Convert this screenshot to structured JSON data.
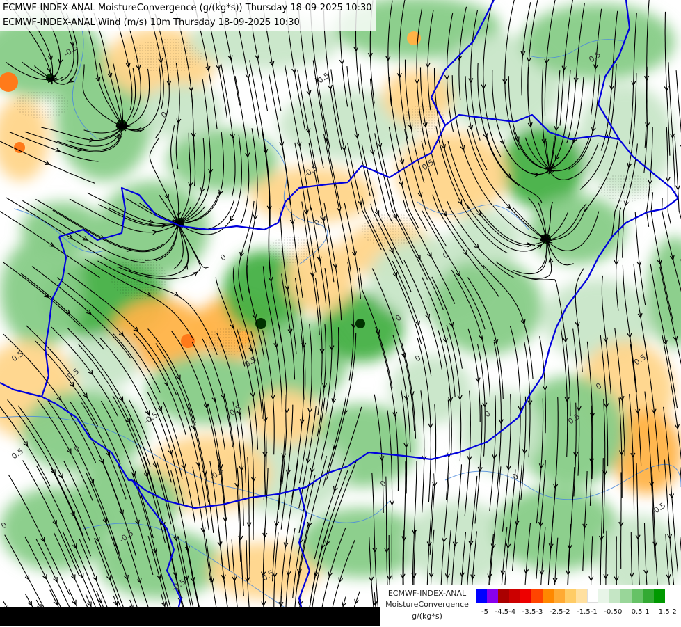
{
  "titles": {
    "line1": "ECMWF-INDEX-ANAL MoistureConvergence (g/(kg*s)) Thursday 18-09-2025 10:30",
    "line2": "ECMWF-INDEX-ANAL Wind (m/s) 10m Thursday 18-09-2025 10:30"
  },
  "legend": {
    "line1": "ECMWF-INDEX-ANAL",
    "line2": "MoistureConvergence",
    "units": "g/(kg*s)",
    "ticks": [
      "-5",
      "-4.5",
      "-4",
      "-3.5",
      "-3",
      "-2.5",
      "-2",
      "-1.5",
      "-1",
      "-0.5",
      "0",
      "0.5",
      "1",
      "1.5",
      "2"
    ],
    "colors": [
      "#0000ff",
      "#8800ee",
      "#aa0000",
      "#cc0000",
      "#ee0000",
      "#ff4400",
      "#ff8800",
      "#ffaa33",
      "#ffcc66",
      "#ffe0a0",
      "#ffffff",
      "#e8f5e8",
      "#c5e6c5",
      "#99d699",
      "#66c266",
      "#33aa33",
      "#009900"
    ]
  },
  "contour_labels": [
    "-0.5",
    "0",
    "0.5"
  ],
  "palette": {
    "border": "#0000dd",
    "river": "#4a88dd",
    "streamline": "#000000",
    "conv_strong": "#44b044",
    "conv_mid": "#88cc88",
    "conv_light": "#c8e6c8",
    "div_light": "#ffd58a",
    "div_mid": "#ffb347",
    "div_strong": "#ff7a1a"
  }
}
